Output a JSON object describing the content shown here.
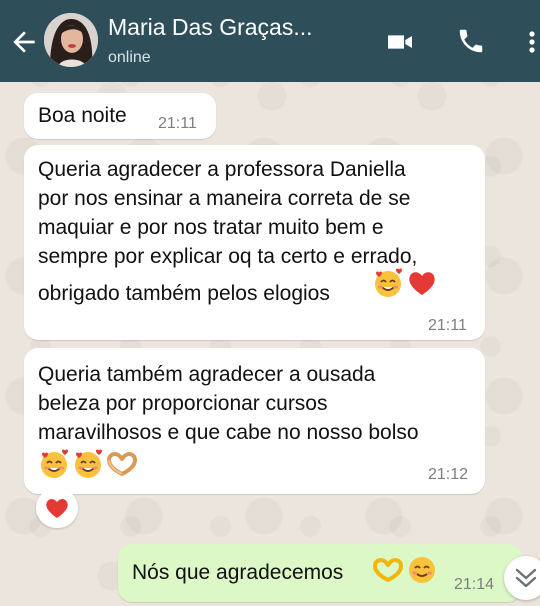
{
  "header": {
    "name": "Maria Das Graças...",
    "status": "online",
    "colors": {
      "bar": "#2e4f5a",
      "text": "#ffffff"
    },
    "icons": [
      "back-arrow-icon",
      "video-call-icon",
      "phone-icon",
      "more-options-icon"
    ]
  },
  "messages": [
    {
      "direction": "incoming",
      "text": "Boa noite",
      "time": "21:11"
    },
    {
      "direction": "incoming",
      "lines": [
        "Queria agradecer a professora Daniella",
        "por nos ensinar a maneira correta de se",
        "maquiar e por nos tratar muito bem e",
        "sempre por explicar oq ta certo e errado,",
        "obrigado também pelos elogios"
      ],
      "emojis": [
        "smiling-face-with-hearts",
        "red-heart"
      ],
      "time": "21:11"
    },
    {
      "direction": "incoming",
      "lines": [
        "Queria também agradecer a ousada",
        "beleza por proporcionar cursos",
        "maravilhosos e que cabe no nosso bolso"
      ],
      "emojis": [
        "smiling-face-with-hearts",
        "smiling-face-with-hearts",
        "heart-hands"
      ],
      "time": "21:12",
      "reaction": "red-heart"
    },
    {
      "direction": "outgoing",
      "text": "Nós que agradecemos",
      "emojis": [
        "heart-hands",
        "smiling-face"
      ],
      "time": "21:14"
    }
  ],
  "colors": {
    "incoming_bubble": "#ffffff",
    "outgoing_bubble": "#dcf8c6",
    "wallpaper": "#ece5dd",
    "timestamp": "#7a7f82"
  },
  "scroll_button_icon": "double-chevron-down-icon"
}
